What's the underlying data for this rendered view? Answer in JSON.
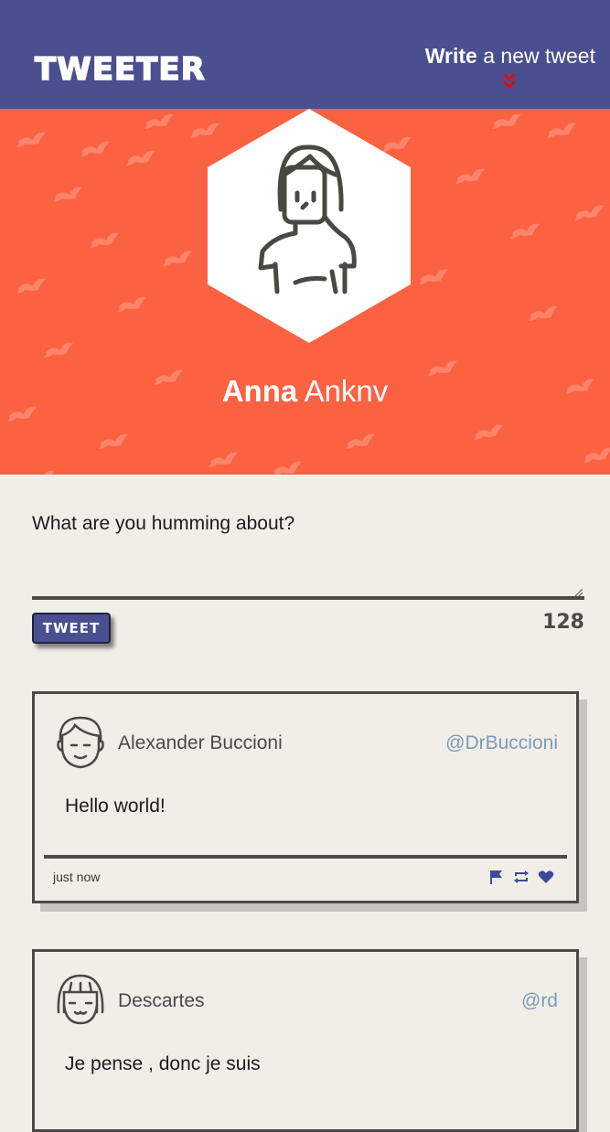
{
  "nav": {
    "logo": "TWEETER",
    "compose_bold": "Write",
    "compose_rest": " a new tweet",
    "arrow_icon": "double-chevron-down-icon"
  },
  "profile": {
    "first_name": "Anna",
    "last_name": "Anknv",
    "background_color": "#fb6242"
  },
  "composer": {
    "placeholder": "What are you humming about?",
    "value": "",
    "button_label": "TWEET",
    "counter": "128"
  },
  "tweets": [
    {
      "name": "Alexander Buccioni",
      "handle": "@DrBuccioni",
      "text": "Hello world!",
      "time": "just now",
      "avatar_icon": "male-avatar-icon"
    },
    {
      "name": "Descartes",
      "handle": "@rd",
      "text": "Je pense , donc je suis",
      "avatar_icon": "female-avatar-icon"
    }
  ],
  "colors": {
    "nav": "#4a4f8f",
    "accent": "#fb6242",
    "background": "#f1eee8",
    "action_blue": "#3b4a9c",
    "handle": "#7a9cb8"
  }
}
